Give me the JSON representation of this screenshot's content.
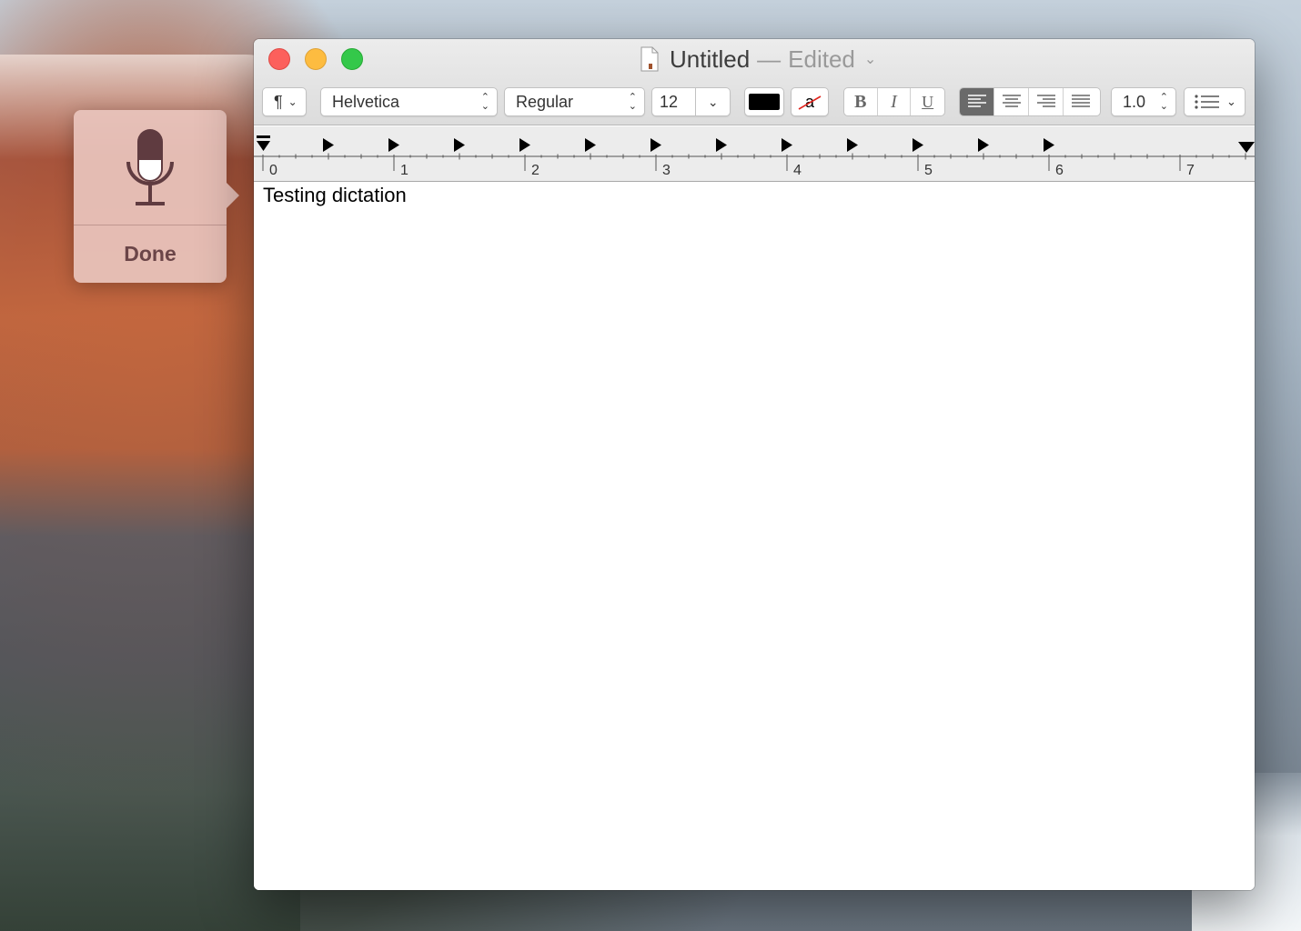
{
  "desktop": {
    "wallpaper": "El Capitan"
  },
  "dictation": {
    "done_label": "Done",
    "icon": "microphone-icon"
  },
  "window": {
    "title": "Untitled",
    "separator": "—",
    "status": "Edited",
    "toolbar": {
      "paragraph_icon": "¶",
      "font_family": "Helvetica",
      "font_style": "Regular",
      "font_size": "12",
      "text_color": "#000000",
      "bold": "B",
      "italic": "I",
      "underline": "U",
      "line_spacing": "1.0",
      "alignment": [
        "left",
        "center",
        "right",
        "justify"
      ],
      "active_alignment": "left"
    },
    "ruler": {
      "numbers": [
        "0",
        "1",
        "2",
        "3",
        "4",
        "5",
        "6",
        "7"
      ]
    },
    "document_text": "Testing dictation"
  }
}
